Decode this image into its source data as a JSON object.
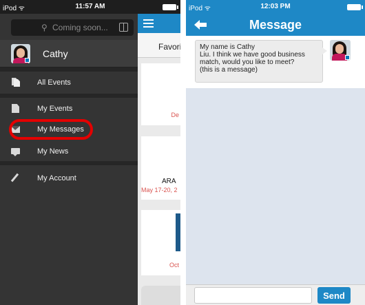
{
  "left": {
    "status": {
      "carrier": "iPod ᯤ",
      "time": "11:57 AM"
    },
    "search": {
      "placeholder": "Coming soon..."
    },
    "profile": {
      "name": "Cathy"
    },
    "menu": [
      {
        "label": "All Events",
        "icon": "documents-icon"
      },
      {
        "label": "My Events",
        "icon": "document-icon"
      },
      {
        "label": "My Messages",
        "icon": "envelope-icon"
      },
      {
        "label": "My News",
        "icon": "chat-icon"
      },
      {
        "label": "My Account",
        "icon": "pencil-icon"
      }
    ],
    "underlying": {
      "tab": "Favorite",
      "card1_date": "De",
      "card2_title": "ARA",
      "card2_date": "May 17-20, 2",
      "card3_date": "Oct"
    },
    "highlight_color": "#e40000"
  },
  "right": {
    "status": {
      "carrier": "iPod ᯤ",
      "time": "12:03 PM"
    },
    "title": "Message",
    "message": "My name is Cathy\nLiu. I think we have good business\nmatch, would you like to meet?\n(this is a message)",
    "send_label": "Send",
    "accent": "#1e88c6"
  }
}
